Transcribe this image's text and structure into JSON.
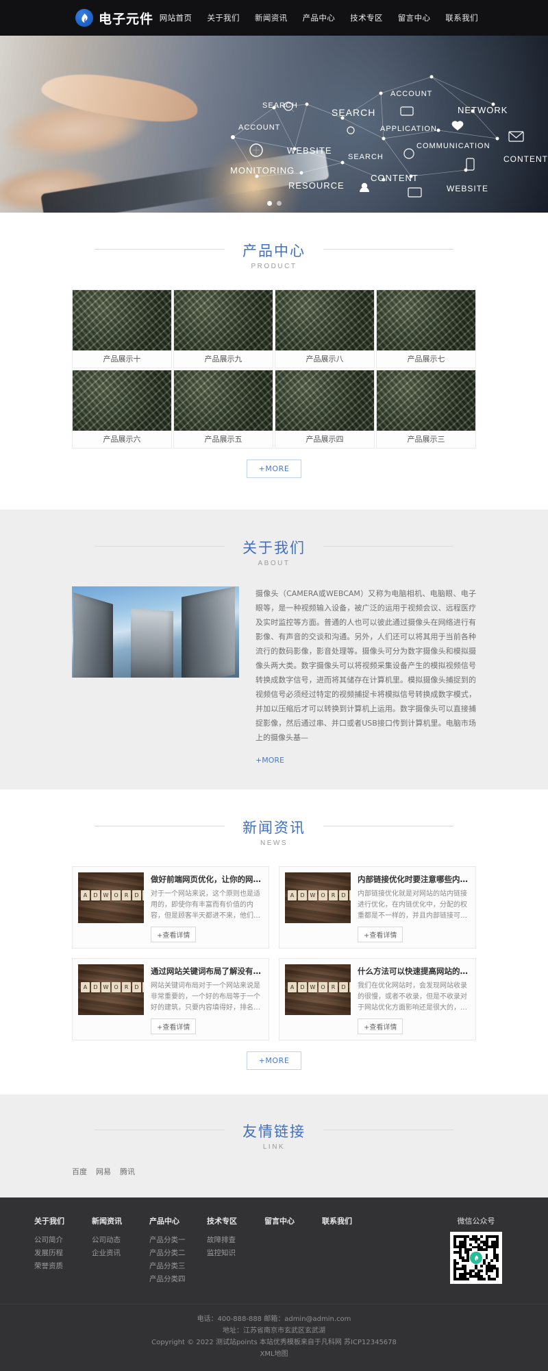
{
  "header": {
    "logo_text": "电子元件",
    "nav": [
      {
        "label": "网站首页"
      },
      {
        "label": "关于我们"
      },
      {
        "label": "新闻资讯"
      },
      {
        "label": "产品中心"
      },
      {
        "label": "技术专区"
      },
      {
        "label": "留言中心"
      },
      {
        "label": "联系我们"
      }
    ]
  },
  "banner": {
    "labels": [
      "ACCOUNT",
      "SEARCH",
      "NETWORK",
      "SEARCH",
      "APPLICATION",
      "ACCOUNT",
      "COMMUNICATION",
      "CONTENT",
      "WEBSITE",
      "SEARCH",
      "MONITORING",
      "CONTENT",
      "RESOURCE",
      "WEBSITE"
    ],
    "slides_total": 2,
    "slide_active": 1
  },
  "products": {
    "title_cn": "产品中心",
    "title_en": "PRODUCT",
    "items": [
      {
        "name": "产品展示十"
      },
      {
        "name": "产品展示九"
      },
      {
        "name": "产品展示八"
      },
      {
        "name": "产品展示七"
      },
      {
        "name": "产品展示六"
      },
      {
        "name": "产品展示五"
      },
      {
        "name": "产品展示四"
      },
      {
        "name": "产品展示三"
      }
    ],
    "more_label": "+MORE"
  },
  "about": {
    "title_cn": "关于我们",
    "title_en": "ABOUT",
    "text": "摄像头（CAMERA或WEBCAM）又称为电脑相机、电脑眼、电子眼等，是一种视频输入设备，被广泛的运用于视频会议、远程医疗及实时监控等方面。普通的人也可以彼此通过摄像头在网络进行有影像、有声音的交谈和沟通。另外，人们还可以将其用于当前各种流行的数码影像，影音处理等。摄像头可分为数字摄像头和模拟摄像头两大类。数字摄像头可以将视频采集设备产生的模拟视频信号转换成数字信号，进而将其储存在计算机里。模拟摄像头捕捉到的视频信号必须经过特定的视频捕捉卡将模拟信号转换成数字模式，并加以压缩后才可以转换到计算机上运用。数字摄像头可以直接捕捉影像，然后通过串、并口或者USB接口传到计算机里。电脑市场上的摄像头基—",
    "more_label": "+MORE"
  },
  "news": {
    "title_cn": "新闻资讯",
    "title_en": "NEWS",
    "btn_label": "+查看详情",
    "thumb_letters": [
      "A",
      "D",
      "W",
      "O",
      "R",
      "D",
      "S"
    ],
    "items": [
      {
        "title": "做好前端网页优化，让你的网站浏览量爆满",
        "desc": "对于一个网站来说，这个原则也是适用的，即使你有丰富而有价值的内容，但是顾客半天都进不来，他们会慢慢失去耐心。尤其是在这个—"
      },
      {
        "title": "内部链接优化时要注意哪些内容?",
        "desc": "内部链接优化就是对网站的站内链接进行优化，在内链优化中，分配的权重都是不一样的，并且内部链接可以提高用户体验，提升访问—"
      },
      {
        "title": "通过网站关键词布局了解没有首页排名的...",
        "desc": "网站关键词布局对于一个网站来说是非常重要的，一个好的布局等于一个好的建筑，只要内容填得好，排名就能更快提高。今天分析这个—"
      },
      {
        "title": "什么方法可以快速提高网站的收录呢?",
        "desc": "我们在优化网站时，会发现网站收录的很慢，或者不收录，但是不收录对于网站优化方面影响还是很大的，那么什么方法可以快速提高网—"
      }
    ],
    "more_label": "+MORE"
  },
  "links": {
    "title_cn": "友情链接",
    "title_en": "LINK",
    "items": [
      {
        "label": "百度"
      },
      {
        "label": "网易"
      },
      {
        "label": "腾讯"
      }
    ]
  },
  "footer": {
    "columns": [
      {
        "title": "关于我们",
        "links": [
          "公司简介",
          "发展历程",
          "荣誉资质"
        ]
      },
      {
        "title": "新闻资讯",
        "links": [
          "公司动态",
          "企业资讯"
        ]
      },
      {
        "title": "产品中心",
        "links": [
          "产品分类一",
          "产品分类二",
          "产品分类三",
          "产品分类四"
        ]
      },
      {
        "title": "技术专区",
        "links": [
          "故障排查",
          "监控知识"
        ]
      },
      {
        "title": "留言中心",
        "links": []
      },
      {
        "title": "联系我们",
        "links": []
      }
    ],
    "qr_label": "微信公众号",
    "contact_line": "电话：400-888-888 邮箱：admin@admin.com",
    "address_line": "地址：江苏省南京市玄武区玄武湖",
    "copyright_line": "Copyright © 2022 测试站points 本站优秀模板来自于凡科网 苏ICP12345678",
    "sitemap_label": "XML地图"
  },
  "colors": {
    "accent": "#3f6fc4",
    "header_bg": "#111113",
    "footer_bg": "#323234",
    "section_alt_bg": "#eeeeee"
  }
}
